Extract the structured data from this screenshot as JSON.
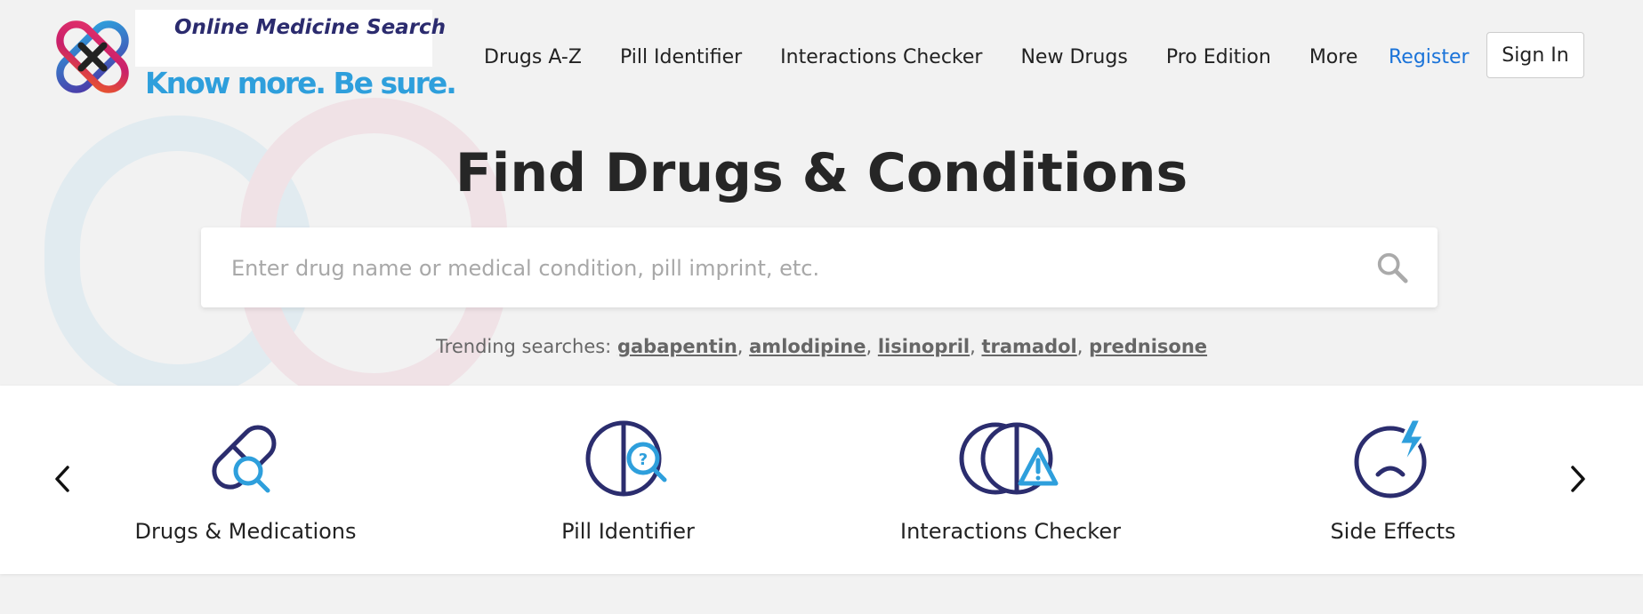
{
  "brand": {
    "title": "Online Medicine Search",
    "tagline": "Know more. Be sure."
  },
  "nav": {
    "items": [
      "Drugs A-Z",
      "Pill Identifier",
      "Interactions Checker",
      "New Drugs",
      "Pro Edition",
      "More"
    ],
    "register": "Register",
    "sign_in": "Sign In"
  },
  "hero": {
    "title": "Find Drugs & Conditions",
    "search_placeholder": "Enter drug name or medical condition, pill imprint, etc.",
    "trending_label": "Trending searches:",
    "trending": [
      "gabapentin",
      "amlodipine",
      "lisinopril",
      "tramadol",
      "prednisone"
    ]
  },
  "categories": [
    {
      "label": "Drugs & Medications",
      "icon": "pill-search-icon"
    },
    {
      "label": "Pill Identifier",
      "icon": "pill-question-icon"
    },
    {
      "label": "Interactions Checker",
      "icon": "interaction-warning-icon"
    },
    {
      "label": "Side Effects",
      "icon": "side-effects-icon"
    }
  ],
  "colors": {
    "navy": "#2b2d6e",
    "accent_blue": "#2e9fdc",
    "link_blue": "#1a73d9",
    "background": "#f2f2f2"
  }
}
